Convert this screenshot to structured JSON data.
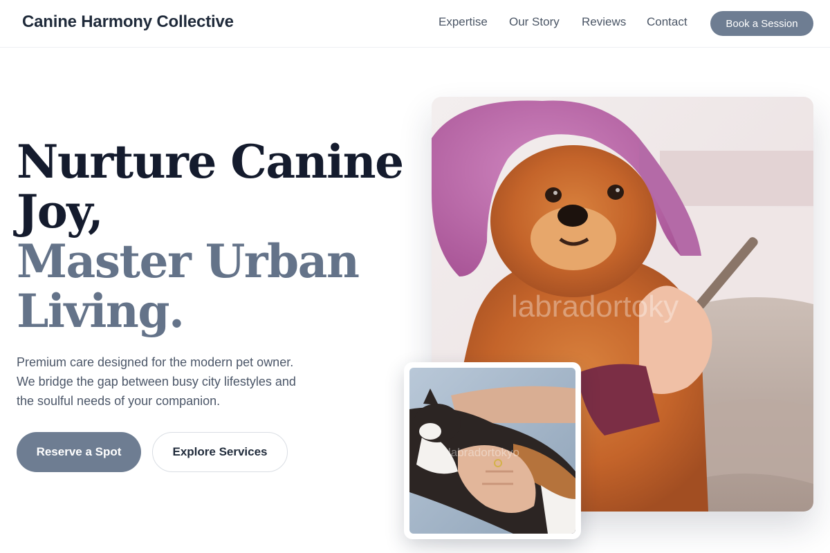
{
  "header": {
    "brand": "Canine Harmony Collective",
    "nav": {
      "expertise": "Expertise",
      "our_story": "Our Story",
      "reviews": "Reviews",
      "contact": "Contact"
    },
    "book_button": "Book a Session"
  },
  "hero": {
    "headline_line1": "Nurture Canine",
    "headline_line2": "Joy,",
    "headline_line3": "Master Urban",
    "headline_line4": "Living.",
    "subtext_line1": "Premium care designed for the modern pet owner.",
    "subtext_line2": "We bridge the gap between busy city lifestyles and",
    "subtext_line3": "the soulful needs of your companion.",
    "primary_cta": "Reserve a Spot",
    "secondary_cta": "Explore Services"
  },
  "images": {
    "main_watermark": "labradortoky",
    "inset_watermark": "labradortokyo"
  },
  "colors": {
    "accent": "#6e7d92",
    "heading_dark": "#141b2d",
    "heading_muted": "#647389",
    "body_text": "#4b5668"
  }
}
